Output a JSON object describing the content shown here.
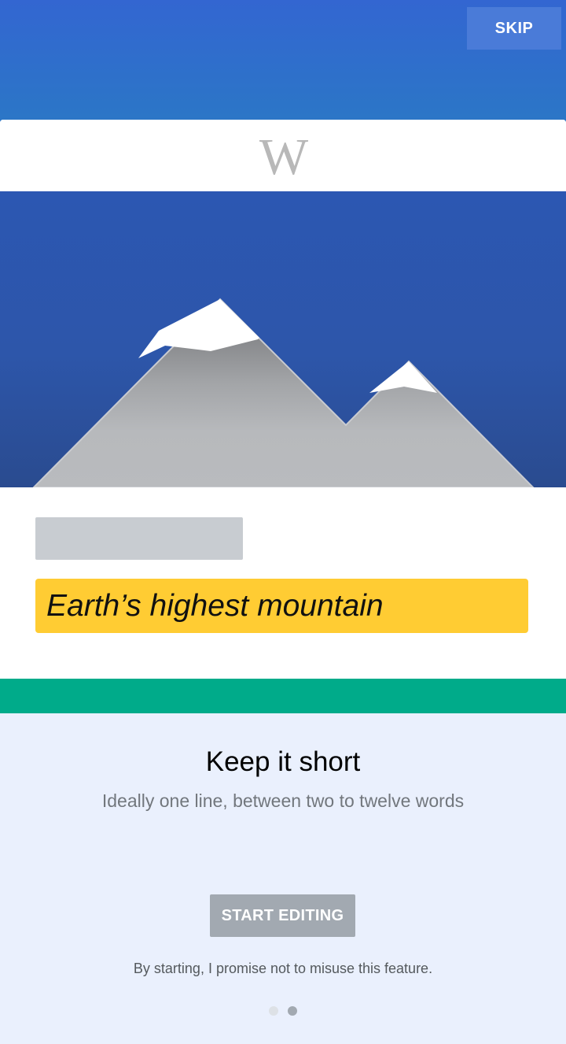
{
  "header": {
    "skip_label": "SKIP"
  },
  "card": {
    "logo_text": "W",
    "description_text": "Earth’s highest mountain"
  },
  "onboarding": {
    "title": "Keep it short",
    "subtitle": "Ideally one line, between two to twelve words",
    "start_button_label": "START EDITING",
    "promise_text": "By starting, I promise not to misuse this feature."
  },
  "pager": {
    "total_pages": 2,
    "current_page": 2
  },
  "colors": {
    "header_blue": "#3366d1",
    "accent_green": "#00ab8a",
    "highlight_yellow": "#ffcc33",
    "disabled_gray": "#a2a9b1"
  },
  "icons": {
    "logo": "wikipedia-w-logo",
    "illustration": "mountain-illustration"
  }
}
